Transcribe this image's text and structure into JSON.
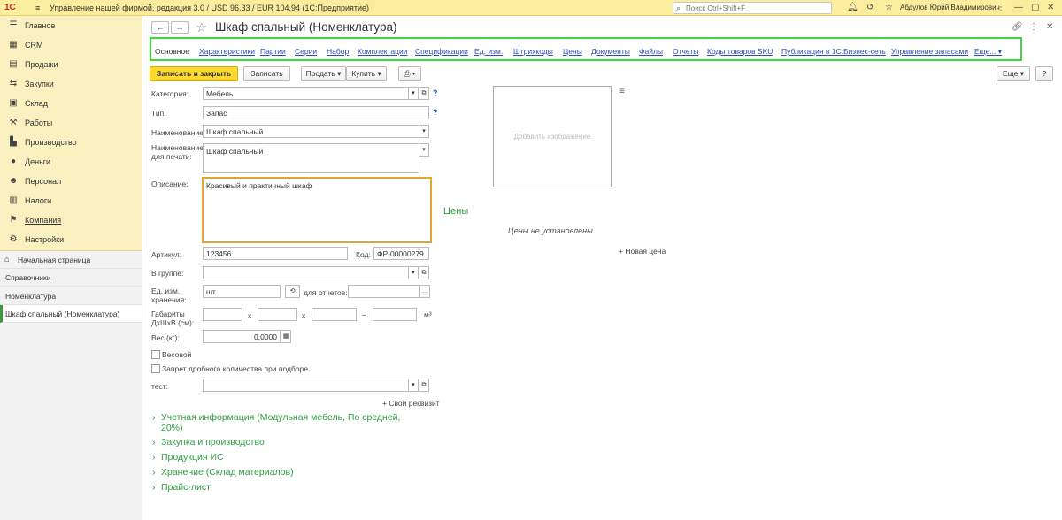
{
  "app": {
    "logo": "1С",
    "title": "Управление нашей фирмой, редакция 3.0 / USD 96,33 / EUR 104,94  (1С:Предприятие)",
    "search_placeholder": "Поиск Ctrl+Shift+F",
    "user": "Абдулов Юрий Владимирович"
  },
  "sidebar": {
    "items": [
      {
        "label": "Главное",
        "icon": "menu-icon"
      },
      {
        "label": "CRM",
        "icon": "crm-icon"
      },
      {
        "label": "Продажи",
        "icon": "sales-icon"
      },
      {
        "label": "Закупки",
        "icon": "purchases-icon"
      },
      {
        "label": "Склад",
        "icon": "warehouse-icon"
      },
      {
        "label": "Работы",
        "icon": "works-icon"
      },
      {
        "label": "Производство",
        "icon": "production-icon"
      },
      {
        "label": "Деньги",
        "icon": "money-icon"
      },
      {
        "label": "Персонал",
        "icon": "staff-icon"
      },
      {
        "label": "Налоги",
        "icon": "taxes-icon"
      },
      {
        "label": "Компания",
        "icon": "company-icon"
      },
      {
        "label": "Настройки",
        "icon": "settings-icon"
      }
    ],
    "nav": [
      {
        "label": "Начальная страница"
      },
      {
        "label": "Справочники"
      },
      {
        "label": "Номенклатура"
      },
      {
        "label": "Шкаф спальный (Номенклатура)"
      }
    ]
  },
  "header": {
    "title": "Шкаф спальный (Номенклатура)"
  },
  "tabs": [
    "Основное",
    "Характеристики",
    "Партии",
    "Серии",
    "Набор",
    "Комплектации",
    "Спецификации",
    "Ед. изм.",
    "Штрихкоды",
    "Цены",
    "Документы",
    "Файлы",
    "Отчеты",
    "Коды товаров SKU",
    "Публикация в 1С:Бизнес-сеть",
    "Управление запасами",
    "Еще..."
  ],
  "toolbar": {
    "save_close": "Записать и закрыть",
    "save": "Записать",
    "sell": "Продать",
    "buy": "Купить",
    "more": "Еще"
  },
  "form": {
    "category_label": "Категория:",
    "category_value": "Мебель",
    "type_label": "Тип:",
    "type_value": "Запас",
    "name_label": "Наименование:",
    "name_value": "Шкаф спальный",
    "print_name_label1": "Наименование",
    "print_name_label2": "для печати:",
    "print_name_value": "Шкаф спальный",
    "description_label": "Описание:",
    "description_value": "Красивый и практичный шкаф",
    "article_label": "Артикул:",
    "article_value": "123456",
    "code_label": "Код:",
    "code_value": "ФР-00000279",
    "group_label": "В группе:",
    "unit_label1": "Ед. изм.",
    "unit_label2": "хранения:",
    "unit_value": "шт",
    "reports_label": "для отчетов:",
    "dims_label1": "Габариты",
    "dims_label2": "ДхШхВ (см):",
    "dims_x": "x",
    "dims_eq": "=",
    "dims_unit": "м³",
    "weight_label": "Вес (кг):",
    "weight_value": "0,0000",
    "weighted_label": "Весовой",
    "fractional_label": "Запрет дробного количества при подборе",
    "test_label": "тест:",
    "custom_attr": "+ Свой реквизит"
  },
  "image": {
    "placeholder": "Добавить изображение"
  },
  "prices": {
    "heading": "Цены",
    "none": "Цены не установлены",
    "new_price": "+ Новая цена"
  },
  "sections": [
    "Учетная информация (Модульная мебель, По средней,",
    "20%)",
    "Закупка и производство",
    "Продукция ИС",
    "Хранение (Склад материалов)",
    "Прайс-лист"
  ],
  "colors": {
    "topbar": "#fbed9e",
    "sidebar": "#fbf1c0",
    "accent_green": "#2f9b42",
    "tab_highlight": "#3cd83c",
    "primary_button": "#fcd930",
    "link": "#2b4dbf"
  }
}
